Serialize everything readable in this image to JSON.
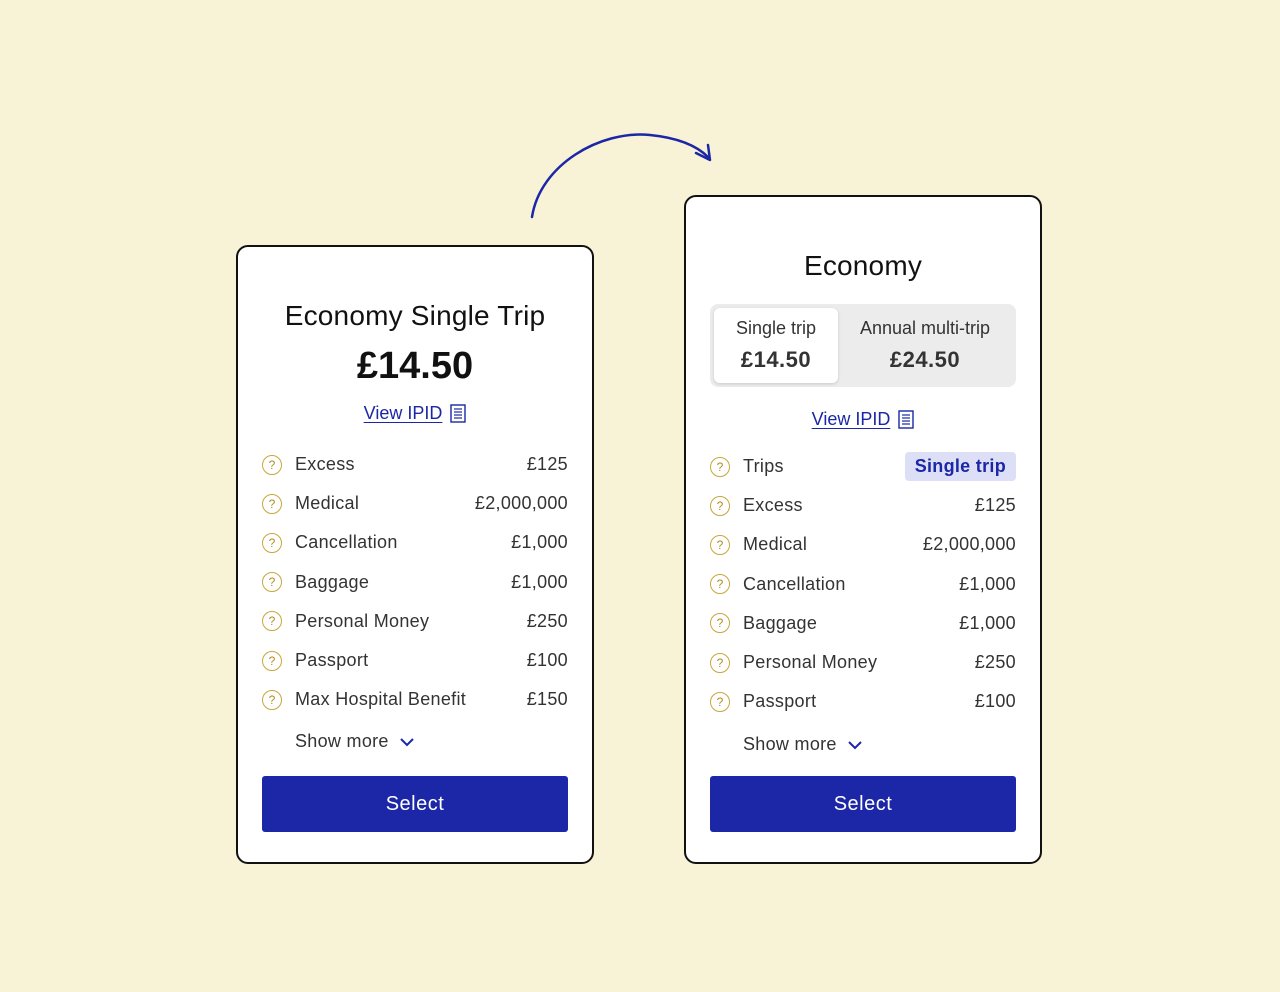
{
  "colors": {
    "background": "#f8f2d6",
    "accent": "#1b27a6",
    "help_icon": "#c8a63a",
    "chip_bg": "#dcdff6"
  },
  "card_a": {
    "title": "Economy Single Trip",
    "price": "£14.50",
    "ipid_label": "View IPID",
    "rows": [
      {
        "label": "Excess",
        "value": "£125"
      },
      {
        "label": "Medical",
        "value": "£2,000,000"
      },
      {
        "label": "Cancellation",
        "value": "£1,000"
      },
      {
        "label": "Baggage",
        "value": "£1,000"
      },
      {
        "label": "Personal Money",
        "value": "£250"
      },
      {
        "label": "Passport",
        "value": "£100"
      },
      {
        "label": "Max Hospital Benefit",
        "value": "£150"
      }
    ],
    "show_more": "Show more",
    "select": "Select"
  },
  "card_b": {
    "title": "Economy",
    "toggle": [
      {
        "label": "Single trip",
        "price": "£14.50",
        "selected": true
      },
      {
        "label": "Annual multi-trip",
        "price": "£24.50",
        "selected": false
      }
    ],
    "ipid_label": "View IPID",
    "trips_row": {
      "label": "Trips",
      "value": "Single trip"
    },
    "rows": [
      {
        "label": "Excess",
        "value": "£125"
      },
      {
        "label": "Medical",
        "value": "£2,000,000"
      },
      {
        "label": "Cancellation",
        "value": "£1,000"
      },
      {
        "label": "Baggage",
        "value": "£1,000"
      },
      {
        "label": "Personal Money",
        "value": "£250"
      },
      {
        "label": "Passport",
        "value": "£100"
      }
    ],
    "show_more": "Show more",
    "select": "Select"
  }
}
